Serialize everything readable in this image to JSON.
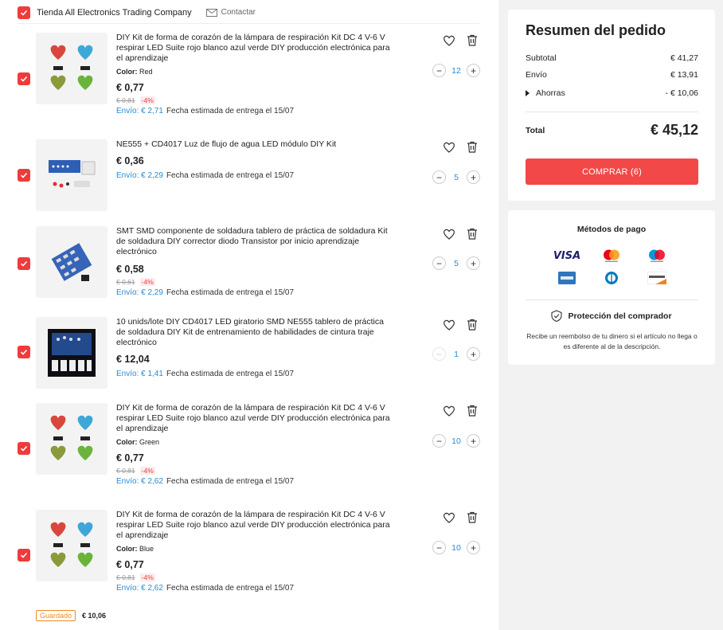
{
  "store": {
    "name": "Tienda All Electronics Trading Company",
    "contact_label": "Contactar"
  },
  "items": [
    {
      "title": "DIY Kit de forma de corazón de la lámpara de respiración Kit DC 4 V-6 V respirar LED Suite rojo blanco azul verde DIY producción electrónica para el aprendizaje",
      "variant_label": "Color:",
      "variant_value": "Red",
      "price": "€ 0,77",
      "original_price": "€ 0,81",
      "discount": "-4%",
      "shipping_fee": "Envío: € 2,71",
      "eta": "Fecha estimada de entrega el 15/07",
      "qty": "12"
    },
    {
      "title": "NE555 + CD4017 Luz de flujo de agua LED módulo DIY Kit",
      "price": "€ 0,36",
      "shipping_fee": "Envío: € 2,29",
      "eta": "Fecha estimada de entrega el 15/07",
      "qty": "5"
    },
    {
      "title": "SMT SMD componente de soldadura tablero de práctica de soldadura Kit de soldadura DIY corrector diodo Transistor por inicio aprendizaje electrónico",
      "price": "€ 0,58",
      "original_price": "€ 0,61",
      "discount": "-4%",
      "shipping_fee": "Envío: € 2,29",
      "eta": "Fecha estimada de entrega el 15/07",
      "qty": "5"
    },
    {
      "title": "10 unids/lote DIY CD4017 LED giratorio SMD NE555 tablero de práctica de soldadura DIY Kit de entrenamiento de habilidades de cintura traje electrónico",
      "price": "€ 12,04",
      "shipping_fee": "Envío: € 1,41",
      "eta": "Fecha estimada de entrega el 15/07",
      "qty": "1"
    },
    {
      "title": "DIY Kit de forma de corazón de la lámpara de respiración Kit DC 4 V-6 V respirar LED Suite rojo blanco azul verde DIY producción electrónica para el aprendizaje",
      "variant_label": "Color:",
      "variant_value": "Green",
      "price": "€ 0,77",
      "original_price": "€ 0,81",
      "discount": "-4%",
      "shipping_fee": "Envío: € 2,62",
      "eta": "Fecha estimada de entrega el 15/07",
      "qty": "10"
    },
    {
      "title": "DIY Kit de forma de corazón de la lámpara de respiración Kit DC 4 V-6 V respirar LED Suite rojo blanco azul verde DIY producción electrónica para el aprendizaje",
      "variant_label": "Color:",
      "variant_value": "Blue",
      "price": "€ 0,77",
      "original_price": "€ 0,81",
      "discount": "-4%",
      "shipping_fee": "Envío: € 2,62",
      "eta": "Fecha estimada de entrega el 15/07",
      "qty": "10"
    }
  ],
  "saved": {
    "tag": "Guardado",
    "amount": "€ 10,06"
  },
  "summary": {
    "title": "Resumen del pedido",
    "subtotal_label": "Subtotal",
    "subtotal_value": "€ 41,27",
    "shipping_label": "Envío",
    "shipping_value": "€ 13,91",
    "savings_label": "Ahorras",
    "savings_value": "- € 10,06",
    "total_label": "Total",
    "total_value": "€ 45,12",
    "buy_label": "COMPRAR (6)"
  },
  "payment": {
    "title": "Métodos de pago",
    "visa_text": "VISA",
    "protection_title": "Protección del comprador",
    "protection_desc": "Recibe un reembolso de tu dinero si el artículo no llega o es diferente al de la descripción."
  },
  "colors": {
    "accent": "#ef3b3b",
    "link": "#2a8ad4",
    "saved": "#f08a24"
  },
  "icons": [
    "check-icon",
    "mail-icon",
    "heart-icon",
    "trash-icon",
    "minus-icon",
    "plus-icon",
    "shield-check-icon",
    "visa-icon",
    "mastercard-icon",
    "maestro-icon",
    "amex-icon",
    "diners-icon",
    "discover-icon"
  ]
}
